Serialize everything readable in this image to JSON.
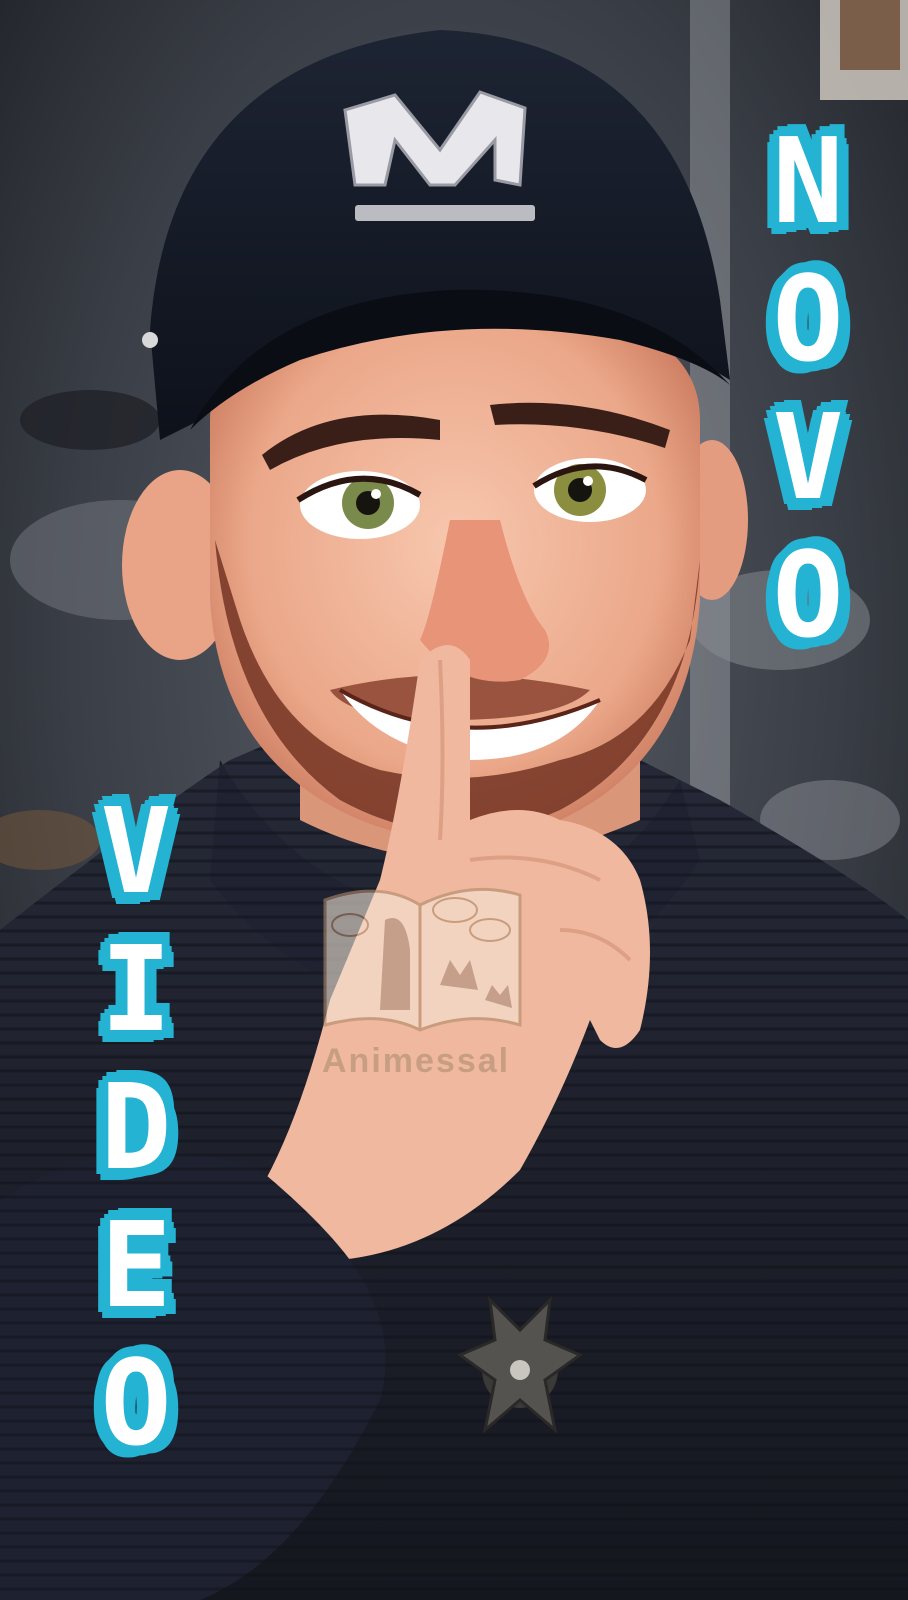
{
  "overlay_text": {
    "top_right": [
      "N",
      "O",
      "V",
      "O"
    ],
    "left": [
      "V",
      "I",
      "D",
      "E",
      "O"
    ]
  },
  "watermark": {
    "text": "Animessal"
  },
  "cap_logo": "M",
  "colors": {
    "text_fill": "#ffffff",
    "text_outline": "#24b3d3",
    "cap": "#141a26",
    "sweater": "#1c1f2b",
    "skin": "#f2b59c",
    "beard": "#7a3a28"
  },
  "icons": {
    "brooch": "decorative-brooch-icon",
    "watermark_logo": "comic-book-icon"
  }
}
